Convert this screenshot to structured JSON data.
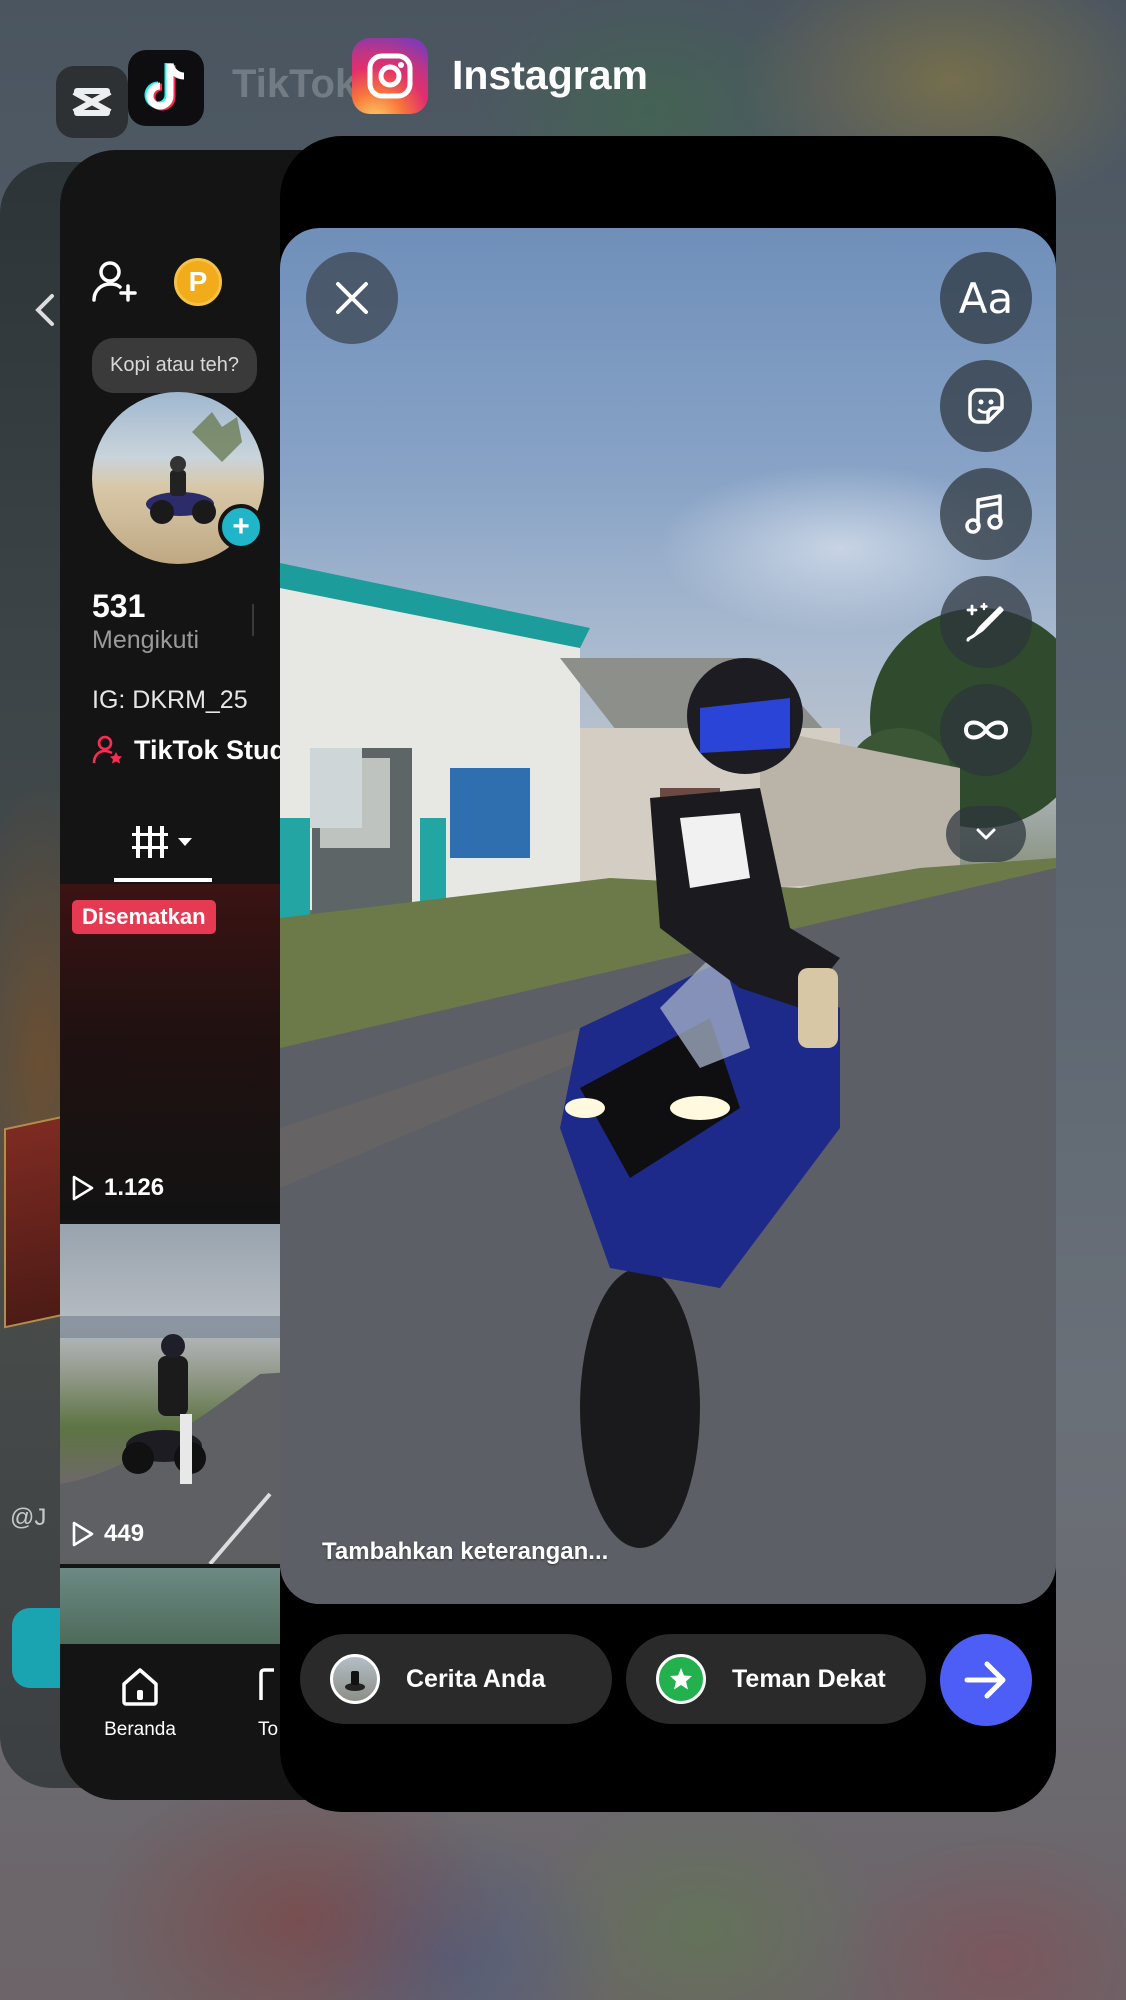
{
  "switcher": {
    "tiktok_label": "TikTok",
    "instagram_label": "Instagram"
  },
  "capcut": {
    "handle_partial": "@J"
  },
  "tiktok": {
    "tooltip": "Kopi atau teh?",
    "coin_letter": "P",
    "following_count": "531",
    "following_label": "Mengikuti",
    "bio": "IG: DKRM_25",
    "studio_link": "TikTok Studio",
    "pinned_badge": "Disematkan",
    "videos": [
      {
        "views": "1.126"
      },
      {
        "views": "449"
      }
    ],
    "nav": {
      "home": "Beranda",
      "second_partial": "To"
    }
  },
  "instagram": {
    "tools": [
      {
        "label": "Aa",
        "icon": "text-icon"
      },
      {
        "icon": "sticker-icon"
      },
      {
        "icon": "music-icon"
      },
      {
        "icon": "draw-icon"
      },
      {
        "icon": "boomerang-icon"
      },
      {
        "icon": "chevron-down-icon"
      }
    ],
    "caption_placeholder": "Tambahkan keterangan...",
    "share": {
      "your_story": "Cerita Anda",
      "close_friends": "Teman Dekat"
    },
    "colors": {
      "next_button": "#4d5ef6",
      "close_friends_green": "#22b14c"
    }
  }
}
